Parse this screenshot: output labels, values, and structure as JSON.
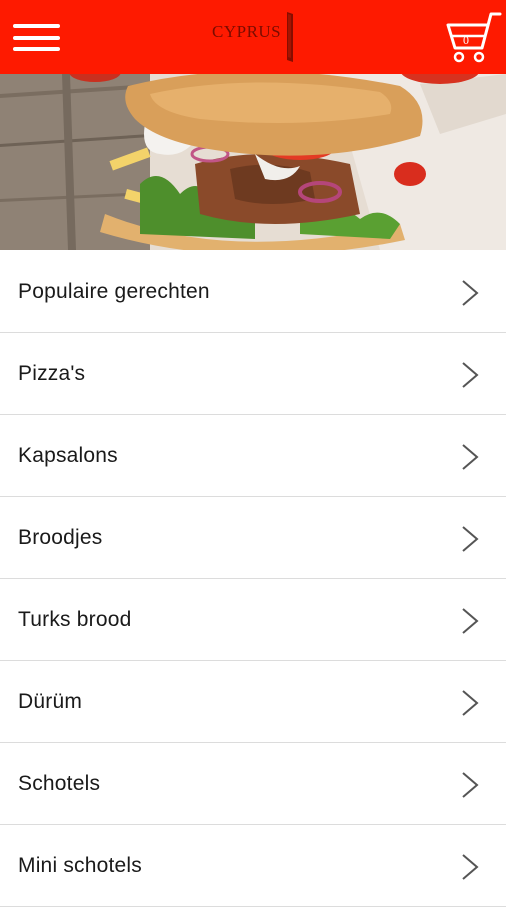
{
  "header": {
    "logo_text": "CYPRUS",
    "cart_count": "0",
    "colors": {
      "brand": "#fe1a00",
      "logo": "#7a0c00"
    }
  },
  "hero": {
    "image": "kebab-sandwich-photo"
  },
  "menu": {
    "items": [
      {
        "label": "Populaire gerechten"
      },
      {
        "label": "Pizza's"
      },
      {
        "label": "Kapsalons"
      },
      {
        "label": "Broodjes"
      },
      {
        "label": "Turks brood"
      },
      {
        "label": "Dürüm"
      },
      {
        "label": "Schotels"
      },
      {
        "label": "Mini schotels"
      }
    ]
  }
}
